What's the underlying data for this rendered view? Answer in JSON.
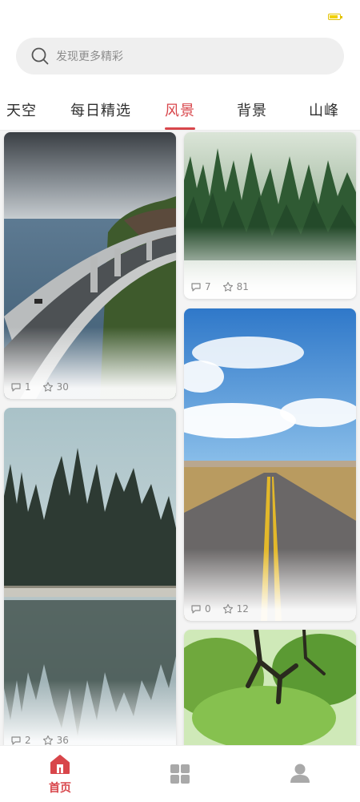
{
  "status_bar": {
    "battery_color": "#f0d000"
  },
  "search": {
    "placeholder": "发现更多精彩"
  },
  "tabs": [
    {
      "label": "天空"
    },
    {
      "label": "每日精选"
    },
    {
      "label": "风景",
      "active": true
    },
    {
      "label": "背景"
    },
    {
      "label": "山峰"
    }
  ],
  "accent_color": "#d8464b",
  "feed": {
    "cards": [
      {
        "image": "coastal-highway-photo",
        "comments": "1",
        "favorites": "30"
      },
      {
        "image": "misty-pine-forest-photo",
        "comments": "7",
        "favorites": "81"
      },
      {
        "image": "lake-forest-reflection-photo",
        "comments": "2",
        "favorites": "36"
      },
      {
        "image": "desert-road-sky-photo",
        "comments": "0",
        "favorites": "12"
      },
      {
        "image": "tree-canopy-photo"
      }
    ]
  },
  "bottom_nav": [
    {
      "label": "首页",
      "icon": "home-icon",
      "active": true
    },
    {
      "label": "",
      "icon": "grid-icon"
    },
    {
      "label": "",
      "icon": "profile-icon"
    }
  ]
}
